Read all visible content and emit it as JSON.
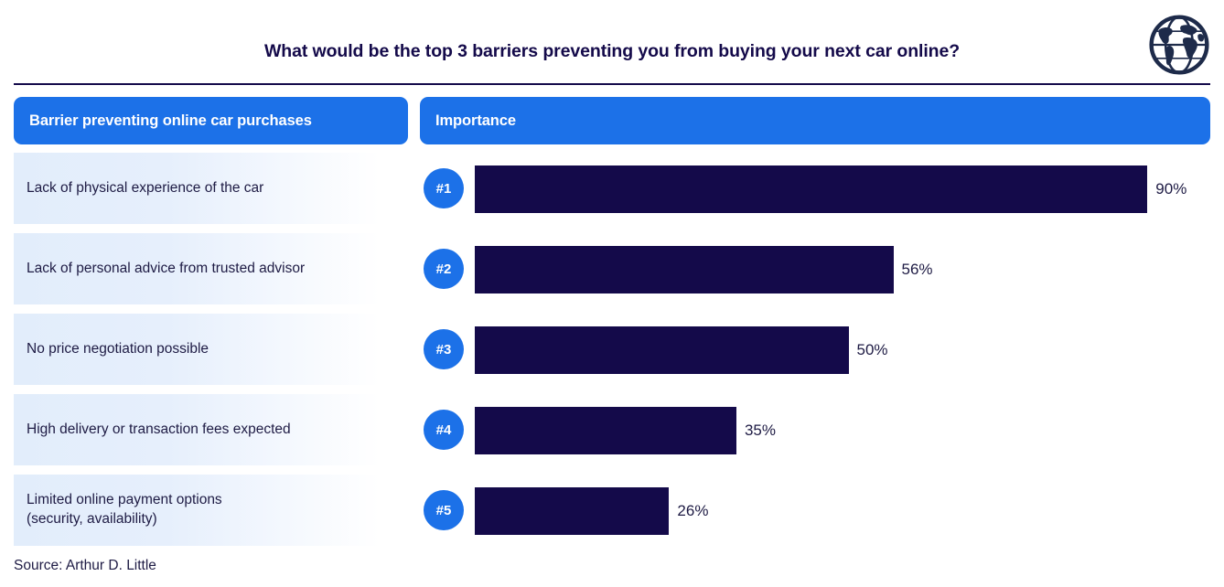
{
  "header": {
    "title": "What would be the top 3 barriers preventing you from buying your next car online?",
    "logo_icon": "globe-icon"
  },
  "table": {
    "col_header_left": "Barrier preventing online car purchases",
    "col_header_right": "Importance"
  },
  "footer": {
    "source": "Source: Arthur D. Little"
  },
  "colors": {
    "accent_blue": "#1c71e8",
    "bar_navy": "#140a4a",
    "text_navy": "#1e1b44",
    "row_band": "#e2edfb"
  },
  "rows": [
    {
      "rank": "#1",
      "label": "Lack of physical experience of the car",
      "value": 90,
      "value_label": "90%"
    },
    {
      "rank": "#2",
      "label": "Lack of personal advice from trusted advisor",
      "value": 56,
      "value_label": "56%"
    },
    {
      "rank": "#3",
      "label": "No price negotiation possible",
      "value": 50,
      "value_label": "50%"
    },
    {
      "rank": "#4",
      "label": "High delivery or transaction fees expected",
      "value": 35,
      "value_label": "35%"
    },
    {
      "rank": "#5",
      "label": "Limited online payment options\n(security, availability)",
      "value": 26,
      "value_label": "26%"
    }
  ],
  "chart_data": {
    "type": "bar",
    "orientation": "horizontal",
    "title": "What would be the top 3 barriers preventing you from buying your next car online?",
    "xlabel": "",
    "ylabel": "",
    "xlim": [
      0,
      100
    ],
    "grid": false,
    "legend": "none",
    "unit": "%",
    "categories": [
      "Lack of physical experience of the car",
      "Lack of personal advice from trusted advisor",
      "No price negotiation possible",
      "High delivery or transaction fees expected",
      "Limited online payment options (security, availability)"
    ],
    "values": [
      90,
      56,
      50,
      35,
      26
    ],
    "data_labels": [
      "90%",
      "56%",
      "50%",
      "35%",
      "26%"
    ],
    "ranks": [
      "#1",
      "#2",
      "#3",
      "#4",
      "#5"
    ],
    "source": "Source: Arthur D. Little",
    "bar_color": "#140a4a"
  }
}
